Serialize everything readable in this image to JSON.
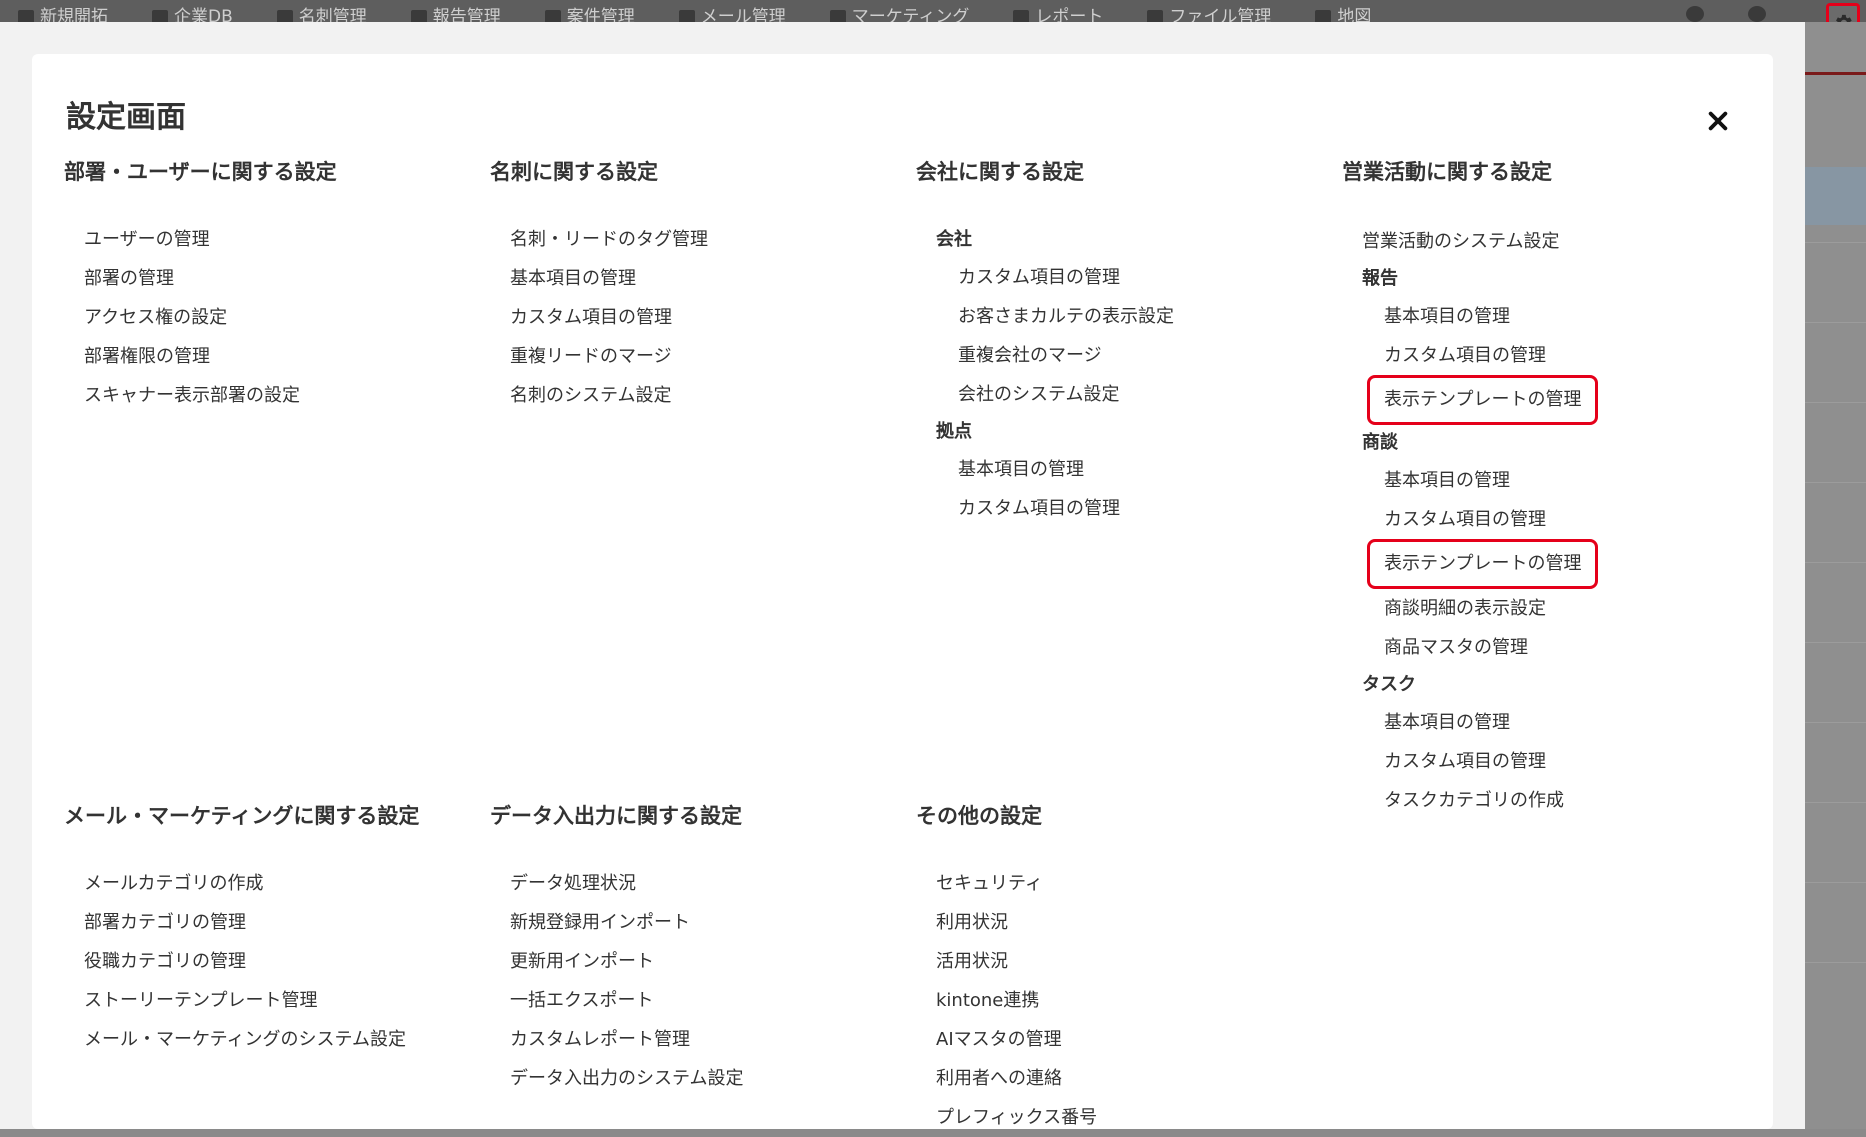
{
  "topbar": {
    "nav": [
      "新規開拓",
      "企業DB",
      "名刺管理",
      "報告管理",
      "案件管理",
      "メール管理",
      "マーケティング",
      "レポート",
      "ファイル管理",
      "地図"
    ]
  },
  "modal": {
    "title": "設定画面",
    "sections": {
      "users": {
        "heading": "部署・ユーザーに関する設定",
        "items": [
          "ユーザーの管理",
          "部署の管理",
          "アクセス権の設定",
          "部署権限の管理",
          "スキャナー表示部署の設定"
        ]
      },
      "cards": {
        "heading": "名刺に関する設定",
        "items": [
          "名刺・リードのタグ管理",
          "基本項目の管理",
          "カスタム項目の管理",
          "重複リードのマージ",
          "名刺のシステム設定"
        ]
      },
      "company": {
        "heading": "会社に関する設定",
        "group1": "会社",
        "group1_items": [
          "カスタム項目の管理",
          "お客さまカルテの表示設定",
          "重複会社のマージ",
          "会社のシステム設定"
        ],
        "group2": "拠点",
        "group2_items": [
          "基本項目の管理",
          "カスタム項目の管理"
        ]
      },
      "sales": {
        "heading": "営業活動に関する設定",
        "top_item": "営業活動のシステム設定",
        "group_report": "報告",
        "report_items": [
          "基本項目の管理",
          "カスタム項目の管理",
          "表示テンプレートの管理"
        ],
        "group_deal": "商談",
        "deal_items": [
          "基本項目の管理",
          "カスタム項目の管理",
          "表示テンプレートの管理",
          "商談明細の表示設定",
          "商品マスタの管理"
        ],
        "group_task": "タスク",
        "task_items": [
          "基本項目の管理",
          "カスタム項目の管理",
          "タスクカテゴリの作成"
        ]
      },
      "mail": {
        "heading": "メール・マーケティングに関する設定",
        "items": [
          "メールカテゴリの作成",
          "部署カテゴリの管理",
          "役職カテゴリの管理",
          "ストーリーテンプレート管理",
          "メール・マーケティングのシステム設定"
        ]
      },
      "data": {
        "heading": "データ入出力に関する設定",
        "items": [
          "データ処理状況",
          "新規登録用インポート",
          "更新用インポート",
          "一括エクスポート",
          "カスタムレポート管理",
          "データ入出力のシステム設定"
        ]
      },
      "other": {
        "heading": "その他の設定",
        "items": [
          "セキュリティ",
          "利用状況",
          "活用状況",
          "kintone連携",
          "AIマスタの管理",
          "利用者への連絡",
          "プレフィックス番号"
        ]
      }
    }
  },
  "colors": {
    "highlight": "#e5001a",
    "text": "#333333"
  }
}
